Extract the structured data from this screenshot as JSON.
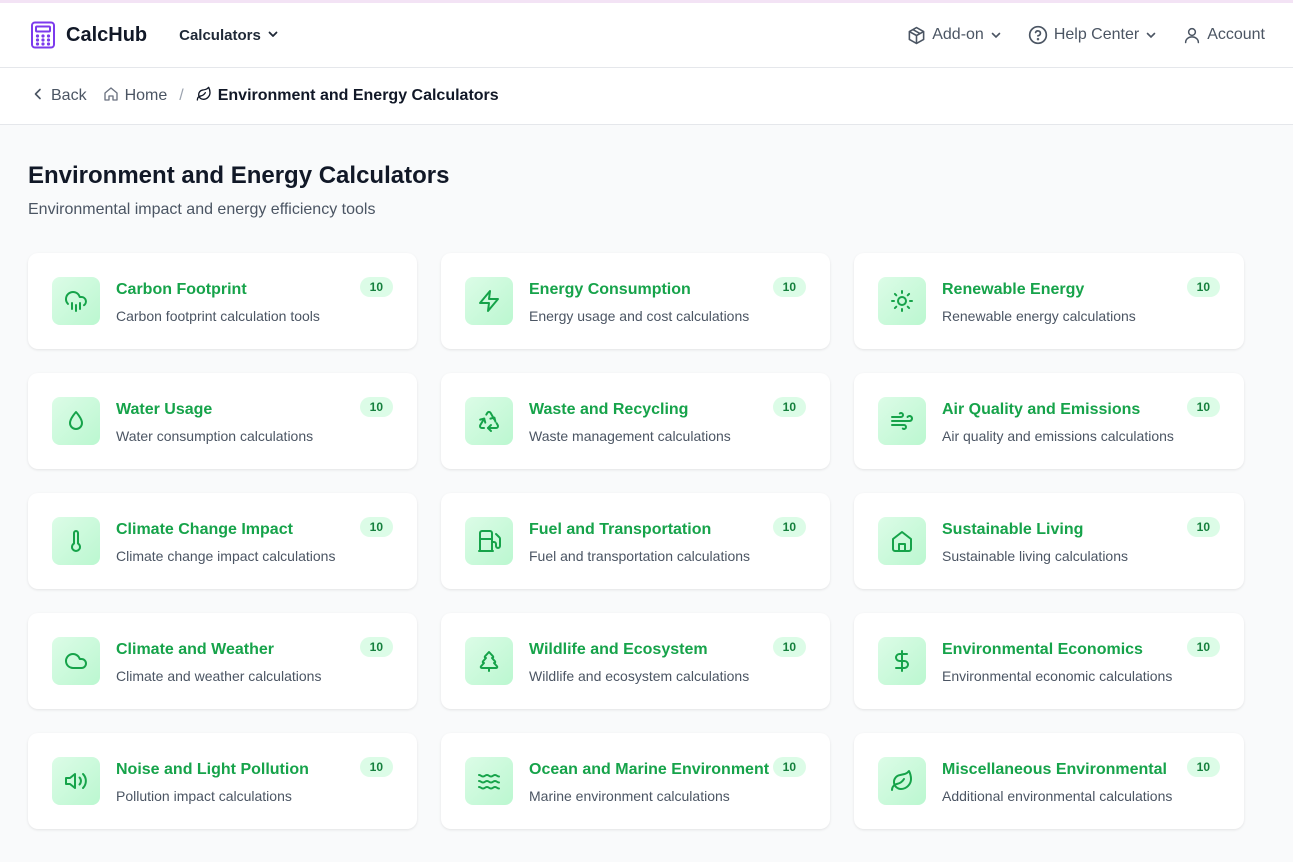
{
  "header": {
    "logo_text": "CalcHub",
    "calculators_label": "Calculators",
    "addon_label": "Add-on",
    "help_label": "Help Center",
    "account_label": "Account"
  },
  "breadcrumb": {
    "back_label": "Back",
    "home_label": "Home",
    "separator": "/",
    "current_label": "Environment and Energy Calculators"
  },
  "page": {
    "title": "Environment and Energy Calculators",
    "subtitle": "Environmental impact and energy efficiency tools"
  },
  "colors": {
    "accent": "#16a34a",
    "icon_bg": "#dcfce7",
    "badge_text": "#15803d",
    "logo": "#7c3aed"
  },
  "cards": [
    {
      "title": "Carbon Footprint",
      "desc": "Carbon footprint calculation tools",
      "count": "10",
      "icon": "cloud-rain-icon"
    },
    {
      "title": "Energy Consumption",
      "desc": "Energy usage and cost calculations",
      "count": "10",
      "icon": "lightning-icon"
    },
    {
      "title": "Renewable Energy",
      "desc": "Renewable energy calculations",
      "count": "10",
      "icon": "sun-icon"
    },
    {
      "title": "Water Usage",
      "desc": "Water consumption calculations",
      "count": "10",
      "icon": "droplet-icon"
    },
    {
      "title": "Waste and Recycling",
      "desc": "Waste management calculations",
      "count": "10",
      "icon": "recycle-icon"
    },
    {
      "title": "Air Quality and Emissions",
      "desc": "Air quality and emissions calculations",
      "count": "10",
      "icon": "wind-icon"
    },
    {
      "title": "Climate Change Impact",
      "desc": "Climate change impact calculations",
      "count": "10",
      "icon": "thermometer-icon"
    },
    {
      "title": "Fuel and Transportation",
      "desc": "Fuel and transportation calculations",
      "count": "10",
      "icon": "fuel-icon"
    },
    {
      "title": "Sustainable Living",
      "desc": "Sustainable living calculations",
      "count": "10",
      "icon": "house-icon"
    },
    {
      "title": "Climate and Weather",
      "desc": "Climate and weather calculations",
      "count": "10",
      "icon": "cloud-icon"
    },
    {
      "title": "Wildlife and Ecosystem",
      "desc": "Wildlife and ecosystem calculations",
      "count": "10",
      "icon": "tree-icon"
    },
    {
      "title": "Environmental Economics",
      "desc": "Environmental economic calculations",
      "count": "10",
      "icon": "dollar-icon"
    },
    {
      "title": "Noise and Light Pollution",
      "desc": "Pollution impact calculations",
      "count": "10",
      "icon": "volume-icon"
    },
    {
      "title": "Ocean and Marine Environment",
      "desc": "Marine environment calculations",
      "count": "10",
      "icon": "waves-icon"
    },
    {
      "title": "Miscellaneous Environmental",
      "desc": "Additional environmental calculations",
      "count": "10",
      "icon": "leaf-icon"
    }
  ]
}
